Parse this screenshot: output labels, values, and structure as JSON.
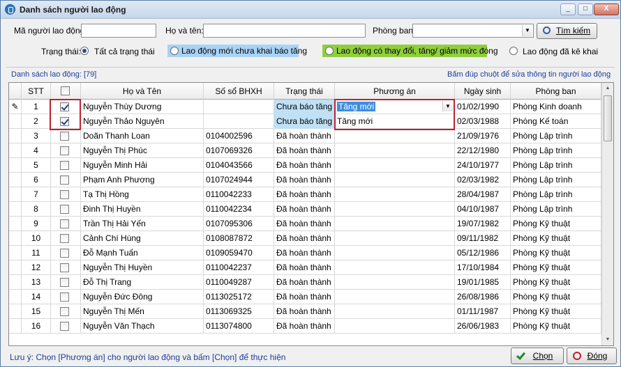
{
  "window": {
    "title": "Danh sách người lao động",
    "min": "_",
    "max": "□",
    "close": "X"
  },
  "search": {
    "ma_label": "Mã người lao động:",
    "ma_value": "",
    "ten_label": "Họ và tên:",
    "ten_value": "",
    "phong_label": "Phòng ban:",
    "phong_value": "",
    "btn": "Tìm kiếm"
  },
  "filter": {
    "label": "Trạng thái:",
    "opt1": "Tất cả trạng thái",
    "opt2": "Lao động mới chưa khai báo tăng",
    "opt3": "Lao động có thay đổi, tăng/ giảm mức đóng",
    "opt4": "Lao động đã kê khai"
  },
  "list_label": "Danh sách lao động: [79]",
  "hint": "Bấm đúp chuột để sửa thông tin người lao động",
  "columns": [
    "STT",
    "",
    "Họ và Tên",
    "Số sổ BHXH",
    "Trạng thái",
    "Phương án",
    "Ngày sinh",
    "Phòng ban"
  ],
  "rows": [
    {
      "stt": "1",
      "checked": true,
      "name": "Nguyễn Thùy Dương",
      "bhxh": "",
      "status": "Chưa báo tăng",
      "pa": "Tăng mới",
      "dob": "01/02/1990",
      "dept": "Phòng Kinh doanh"
    },
    {
      "stt": "2",
      "checked": true,
      "name": "Nguyễn Thảo Nguyên",
      "bhxh": "",
      "status": "Chưa báo tăng",
      "pa": "Tăng mới",
      "dob": "02/03/1988",
      "dept": "Phòng Kế toán"
    },
    {
      "stt": "3",
      "checked": false,
      "name": "Doãn Thanh Loan",
      "bhxh": "0104002596",
      "status": "Đã hoàn thành",
      "pa": "",
      "dob": "21/09/1976",
      "dept": "Phòng Lập trình"
    },
    {
      "stt": "4",
      "checked": false,
      "name": "Nguyễn Thị Phúc",
      "bhxh": "0107069326",
      "status": "Đã hoàn thành",
      "pa": "",
      "dob": "22/12/1980",
      "dept": "Phòng Lập trình"
    },
    {
      "stt": "5",
      "checked": false,
      "name": "Nguyễn Minh Hải",
      "bhxh": "0104043566",
      "status": "Đã hoàn thành",
      "pa": "",
      "dob": "24/10/1977",
      "dept": "Phòng Lập trình"
    },
    {
      "stt": "6",
      "checked": false,
      "name": "Phạm Anh Phương",
      "bhxh": "0107024944",
      "status": "Đã hoàn thành",
      "pa": "",
      "dob": "02/03/1982",
      "dept": "Phòng Lập trình"
    },
    {
      "stt": "7",
      "checked": false,
      "name": "Tạ Thị Hồng",
      "bhxh": "0110042233",
      "status": "Đã hoàn thành",
      "pa": "",
      "dob": "28/04/1987",
      "dept": "Phòng Lập trình"
    },
    {
      "stt": "8",
      "checked": false,
      "name": "Đinh Thị Huyền",
      "bhxh": "0110042234",
      "status": "Đã hoàn thành",
      "pa": "",
      "dob": "04/10/1987",
      "dept": "Phòng Lập trình"
    },
    {
      "stt": "9",
      "checked": false,
      "name": "Trần Thị Hải Yến",
      "bhxh": "0107095306",
      "status": "Đã hoàn thành",
      "pa": "",
      "dob": "19/07/1982",
      "dept": "Phòng Kỹ thuật"
    },
    {
      "stt": "10",
      "checked": false,
      "name": "Cảnh Chí Hùng",
      "bhxh": "0108087872",
      "status": "Đã hoàn thành",
      "pa": "",
      "dob": "09/11/1982",
      "dept": "Phòng Kỹ thuật"
    },
    {
      "stt": "11",
      "checked": false,
      "name": "Đỗ Mạnh Tuấn",
      "bhxh": "0109059470",
      "status": "Đã hoàn thành",
      "pa": "",
      "dob": "05/12/1986",
      "dept": "Phòng Kỹ thuật"
    },
    {
      "stt": "12",
      "checked": false,
      "name": "Nguyễn Thị Huyền",
      "bhxh": "0110042237",
      "status": "Đã hoàn thành",
      "pa": "",
      "dob": "17/10/1984",
      "dept": "Phòng Kỹ thuật"
    },
    {
      "stt": "13",
      "checked": false,
      "name": "Đỗ Thị Trang",
      "bhxh": "0110049287",
      "status": "Đã hoàn thành",
      "pa": "",
      "dob": "19/01/1985",
      "dept": "Phòng Kỹ thuật"
    },
    {
      "stt": "14",
      "checked": false,
      "name": "Nguyễn Đức Đông",
      "bhxh": "0113025172",
      "status": "Đã hoàn thành",
      "pa": "",
      "dob": "26/08/1986",
      "dept": "Phòng Kỹ thuật"
    },
    {
      "stt": "15",
      "checked": false,
      "name": "Nguyễn Thị Mến",
      "bhxh": "0113069325",
      "status": "Đã hoàn thành",
      "pa": "",
      "dob": "01/11/1987",
      "dept": "Phòng Kỹ thuật"
    },
    {
      "stt": "16",
      "checked": false,
      "name": "Nguyễn Văn Thạch",
      "bhxh": "0113074800",
      "status": "Đã hoàn thành",
      "pa": "",
      "dob": "26/06/1983",
      "dept": "Phòng Kỹ thuật"
    }
  ],
  "footer_note": "Lưu ý: Chọn [Phương án] cho người lao động và bấm [Chọn] để thực hiện",
  "btn_chon": "Chọn",
  "btn_dong": "Đóng",
  "colors": {
    "status_new": "#bfe0f5",
    "pill_blue": "#a9d3f5",
    "pill_green": "#8fcf3c",
    "red": "#c0202e"
  }
}
